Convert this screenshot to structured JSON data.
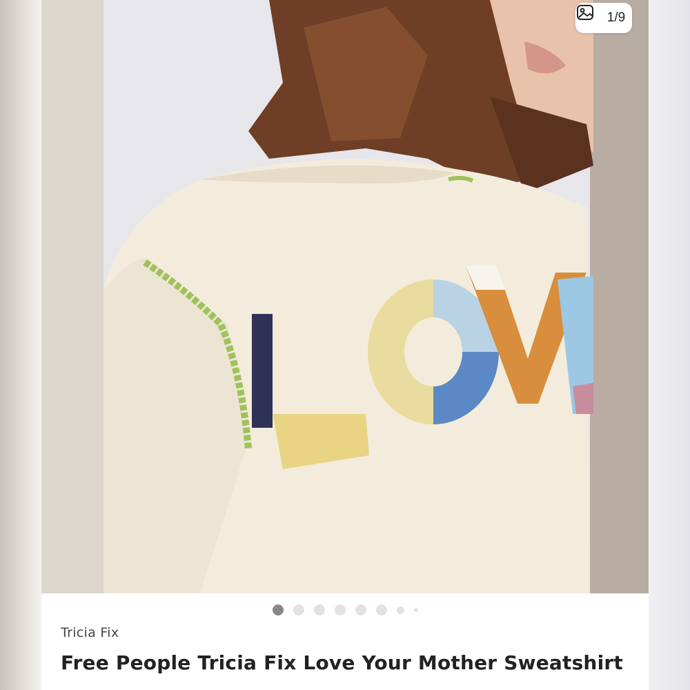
{
  "gallery": {
    "counter_text": "1/9",
    "counter_icon": "image-icon",
    "total_images": 9,
    "active_index": 1
  },
  "product": {
    "brand": "Tricia Fix",
    "title": "Free People Tricia Fix Love Your Mother Sweatshirt"
  },
  "photo": {
    "garment_text": "LOVE"
  },
  "colors": {
    "dot_active": "#888888",
    "dot_inactive": "#e2e2e2",
    "text_primary": "#222222"
  }
}
